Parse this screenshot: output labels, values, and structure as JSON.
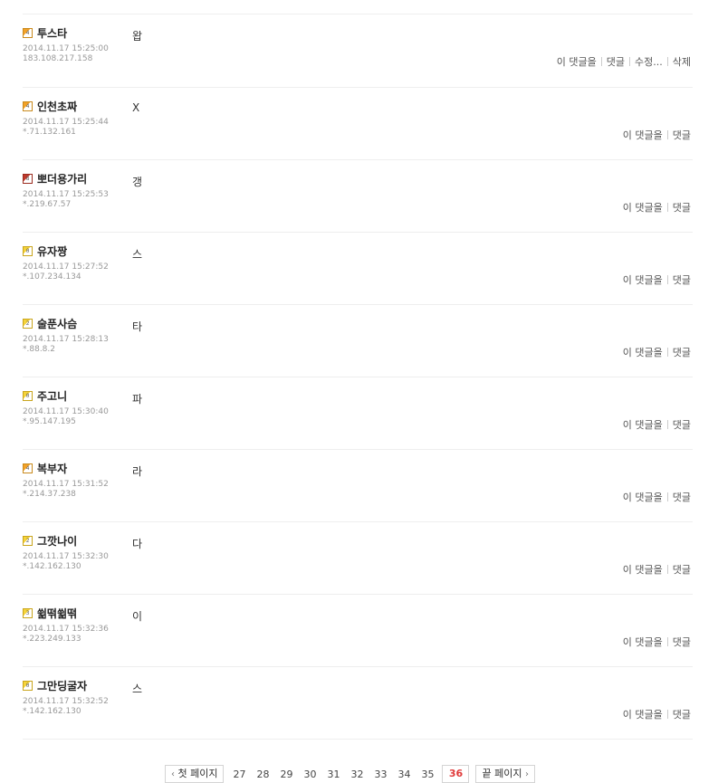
{
  "comments": [
    {
      "nickname": "투스타",
      "level": "4",
      "level_color": "orange",
      "datetime": "2014.11.17 15:25:00",
      "ip": "183.108.217.158",
      "content": "왑",
      "actions": [
        "이 댓글을",
        "댓글",
        "수정...",
        "삭제"
      ]
    },
    {
      "nickname": "인천초짜",
      "level": "4",
      "level_color": "orange",
      "datetime": "2014.11.17 15:25:44",
      "ip": "*.71.132.161",
      "content": "X",
      "actions": [
        "이 댓글을",
        "댓글"
      ]
    },
    {
      "nickname": "뽀더용가리",
      "level": "8",
      "level_color": "red",
      "datetime": "2014.11.17 15:25:53",
      "ip": "*.219.67.57",
      "content": "갱",
      "actions": [
        "이 댓글을",
        "댓글"
      ]
    },
    {
      "nickname": "유자짱",
      "level": "0",
      "level_color": "yellow",
      "datetime": "2014.11.17 15:27:52",
      "ip": "*.107.234.134",
      "content": "스",
      "actions": [
        "이 댓글을",
        "댓글"
      ]
    },
    {
      "nickname": "술푼사슴",
      "level": "2",
      "level_color": "yellow",
      "datetime": "2014.11.17 15:28:13",
      "ip": "*.88.8.2",
      "content": "타",
      "actions": [
        "이 댓글을",
        "댓글"
      ]
    },
    {
      "nickname": "주고니",
      "level": "0",
      "level_color": "yellow",
      "datetime": "2014.11.17 15:30:40",
      "ip": "*.95.147.195",
      "content": "파",
      "actions": [
        "이 댓글을",
        "댓글"
      ]
    },
    {
      "nickname": "복부자",
      "level": "4",
      "level_color": "orange",
      "datetime": "2014.11.17 15:31:52",
      "ip": "*.214.37.238",
      "content": "라",
      "actions": [
        "이 댓글을",
        "댓글"
      ]
    },
    {
      "nickname": "그깟나이",
      "level": "2",
      "level_color": "yellow",
      "datetime": "2014.11.17 15:32:30",
      "ip": "*.142.162.130",
      "content": "다",
      "actions": [
        "이 댓글을",
        "댓글"
      ]
    },
    {
      "nickname": "쓂떢쓂떢",
      "level": "3",
      "level_color": "yellow",
      "datetime": "2014.11.17 15:32:36",
      "ip": "*.223.249.133",
      "content": "이",
      "actions": [
        "이 댓글을",
        "댓글"
      ]
    },
    {
      "nickname": "그만딩굴자",
      "level": "0",
      "level_color": "yellow",
      "datetime": "2014.11.17 15:32:52",
      "ip": "*.142.162.130",
      "content": "스",
      "actions": [
        "이 댓글을",
        "댓글"
      ]
    }
  ],
  "pagination": {
    "first_label": "첫 페이지",
    "last_label": "끝 페이지",
    "pages": [
      "27",
      "28",
      "29",
      "30",
      "31",
      "32",
      "33",
      "34",
      "35",
      "36"
    ],
    "current": "36",
    "prev_icon": "chevron-left-icon",
    "next_icon": "chevron-right-icon"
  },
  "colors": {
    "current_page": "#e03b3b",
    "meta_text": "#999999",
    "divider": "#eeeeee"
  }
}
